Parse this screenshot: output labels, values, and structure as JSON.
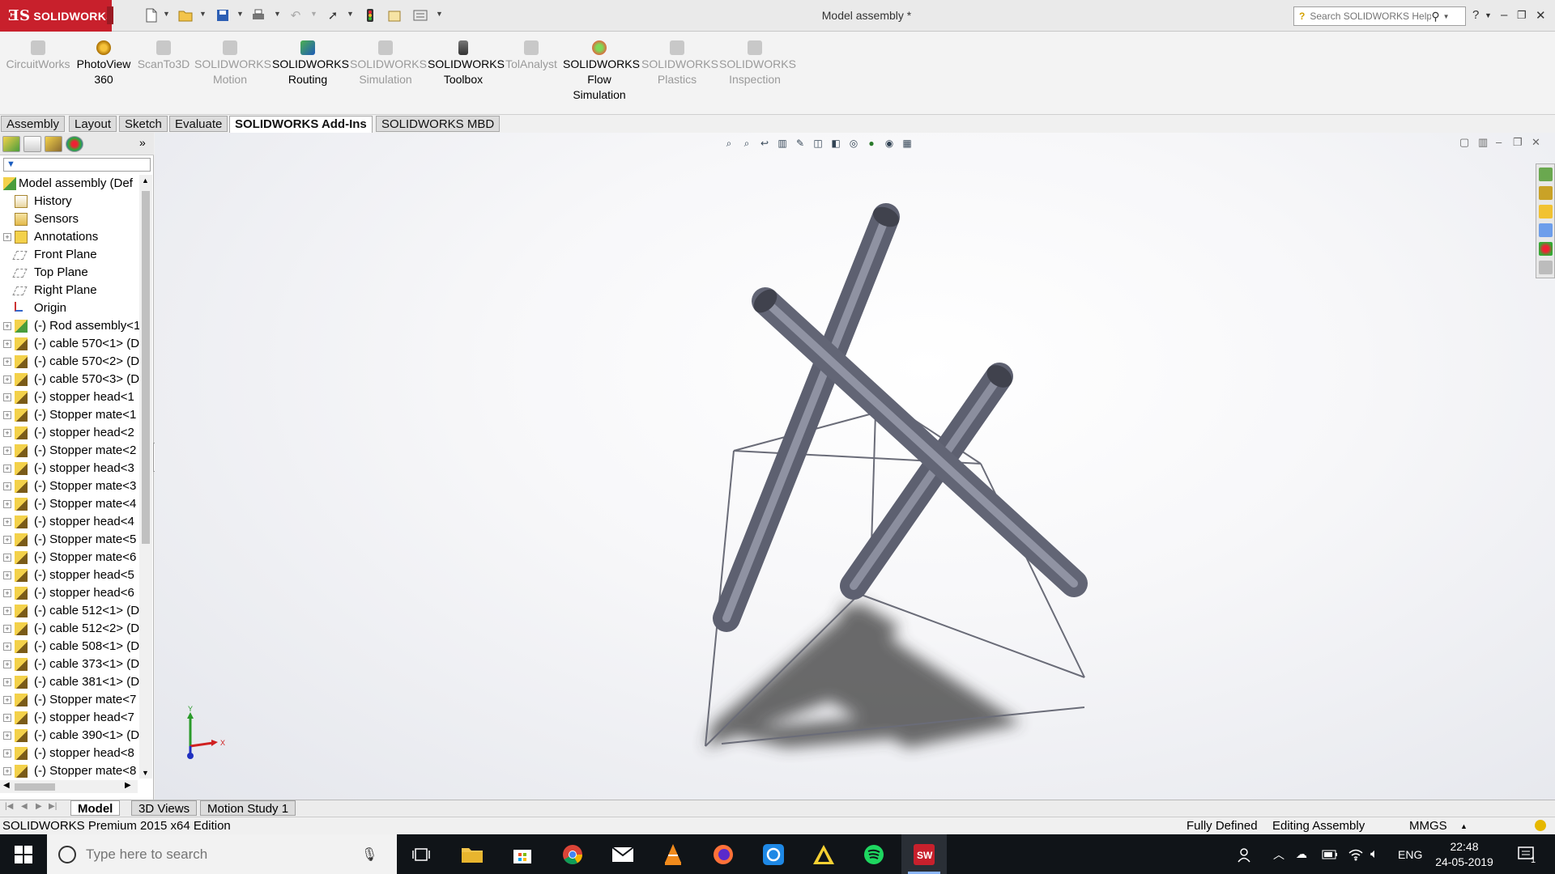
{
  "app": {
    "logo_text": "SOLIDWORKS",
    "document_title": "Model assembly *",
    "search_placeholder": "Search SOLIDWORKS Help"
  },
  "ribbon": {
    "buttons": [
      {
        "line1": "CircuitWorks",
        "line2": "",
        "line3": "",
        "enabled": false
      },
      {
        "line1": "PhotoView",
        "line2": "360",
        "line3": "",
        "enabled": true
      },
      {
        "line1": "ScanTo3D",
        "line2": "",
        "line3": "",
        "enabled": false
      },
      {
        "line1": "SOLIDWORKS",
        "line2": "Motion",
        "line3": "",
        "enabled": false
      },
      {
        "line1": "SOLIDWORKS",
        "line2": "Routing",
        "line3": "",
        "enabled": true
      },
      {
        "line1": "SOLIDWORKS",
        "line2": "Simulation",
        "line3": "",
        "enabled": false
      },
      {
        "line1": "SOLIDWORKS",
        "line2": "Toolbox",
        "line3": "",
        "enabled": true
      },
      {
        "line1": "TolAnalyst",
        "line2": "",
        "line3": "",
        "enabled": false
      },
      {
        "line1": "SOLIDWORKS",
        "line2": "Flow",
        "line3": "Simulation",
        "enabled": true
      },
      {
        "line1": "SOLIDWORKS",
        "line2": "Plastics",
        "line3": "",
        "enabled": false
      },
      {
        "line1": "SOLIDWORKS",
        "line2": "Inspection",
        "line3": "",
        "enabled": false
      }
    ]
  },
  "command_tabs": [
    "Assembly",
    "Layout",
    "Sketch",
    "Evaluate",
    "SOLIDWORKS Add-Ins",
    "SOLIDWORKS MBD"
  ],
  "active_command_tab": "SOLIDWORKS Add-Ins",
  "feature_tree": {
    "root": "Model assembly  (Def",
    "items": [
      {
        "label": "History",
        "icon": "history-icon",
        "expandable": false
      },
      {
        "label": "Sensors",
        "icon": "sensors-icon",
        "expandable": false
      },
      {
        "label": "Annotations",
        "icon": "annotations-icon",
        "expandable": true
      },
      {
        "label": "Front Plane",
        "icon": "plane-icon",
        "expandable": false
      },
      {
        "label": "Top Plane",
        "icon": "plane-icon",
        "expandable": false
      },
      {
        "label": "Right Plane",
        "icon": "plane-icon",
        "expandable": false
      },
      {
        "label": "Origin",
        "icon": "origin-icon",
        "expandable": false
      },
      {
        "label": "(-) Rod assembly<1",
        "icon": "subassembly-icon",
        "expandable": true
      },
      {
        "label": "(-) cable 570<1> (D",
        "icon": "part-icon",
        "expandable": true
      },
      {
        "label": "(-) cable 570<2> (D",
        "icon": "part-icon",
        "expandable": true
      },
      {
        "label": "(-) cable 570<3> (D",
        "icon": "part-icon",
        "expandable": true
      },
      {
        "label": "(-) stopper head<1",
        "icon": "part-icon",
        "expandable": true
      },
      {
        "label": "(-) Stopper mate<1",
        "icon": "part-icon",
        "expandable": true
      },
      {
        "label": "(-) stopper head<2",
        "icon": "part-icon",
        "expandable": true
      },
      {
        "label": "(-) Stopper mate<2",
        "icon": "part-icon",
        "expandable": true
      },
      {
        "label": "(-) stopper head<3",
        "icon": "part-icon",
        "expandable": true
      },
      {
        "label": "(-) Stopper mate<3",
        "icon": "part-icon",
        "expandable": true
      },
      {
        "label": "(-) Stopper mate<4",
        "icon": "part-icon",
        "expandable": true
      },
      {
        "label": "(-) stopper head<4",
        "icon": "part-icon",
        "expandable": true
      },
      {
        "label": "(-) Stopper mate<5",
        "icon": "part-icon",
        "expandable": true
      },
      {
        "label": "(-) Stopper mate<6",
        "icon": "part-icon",
        "expandable": true
      },
      {
        "label": "(-) stopper head<5",
        "icon": "part-icon",
        "expandable": true
      },
      {
        "label": "(-) stopper head<6",
        "icon": "part-icon",
        "expandable": true
      },
      {
        "label": "(-) cable 512<1> (D",
        "icon": "part-icon",
        "expandable": true
      },
      {
        "label": "(-) cable 512<2> (D",
        "icon": "part-icon",
        "expandable": true
      },
      {
        "label": "(-) cable 508<1> (D",
        "icon": "part-icon",
        "expandable": true
      },
      {
        "label": "(-) cable 373<1> (D",
        "icon": "part-icon",
        "expandable": true
      },
      {
        "label": "(-) cable 381<1> (D",
        "icon": "part-icon",
        "expandable": true
      },
      {
        "label": "(-) Stopper mate<7",
        "icon": "part-icon",
        "expandable": true
      },
      {
        "label": "(-) stopper head<7",
        "icon": "part-icon",
        "expandable": true
      },
      {
        "label": "(-) cable 390<1> (D",
        "icon": "part-icon",
        "expandable": true
      },
      {
        "label": "(-) stopper head<8",
        "icon": "part-icon",
        "expandable": true
      },
      {
        "label": "(-) Stopper mate<8",
        "icon": "part-icon",
        "expandable": true
      }
    ]
  },
  "triad": {
    "x": "X",
    "y": "Y"
  },
  "bottom_tabs": [
    "Model",
    "3D Views",
    "Motion Study 1"
  ],
  "active_bottom_tab": "Model",
  "status": {
    "edition": "SOLIDWORKS Premium 2015 x64 Edition",
    "definition": "Fully Defined",
    "mode": "Editing Assembly",
    "units": "MMGS"
  },
  "taskbar": {
    "search_placeholder": "Type here to search",
    "language": "ENG",
    "time": "22:48",
    "date": "24-05-2019",
    "notification_count": "1"
  },
  "colors": {
    "brand": "#c8202c",
    "rod": "#6b6e7c",
    "cable": "#6a6c78",
    "taskbar": "#101418"
  }
}
